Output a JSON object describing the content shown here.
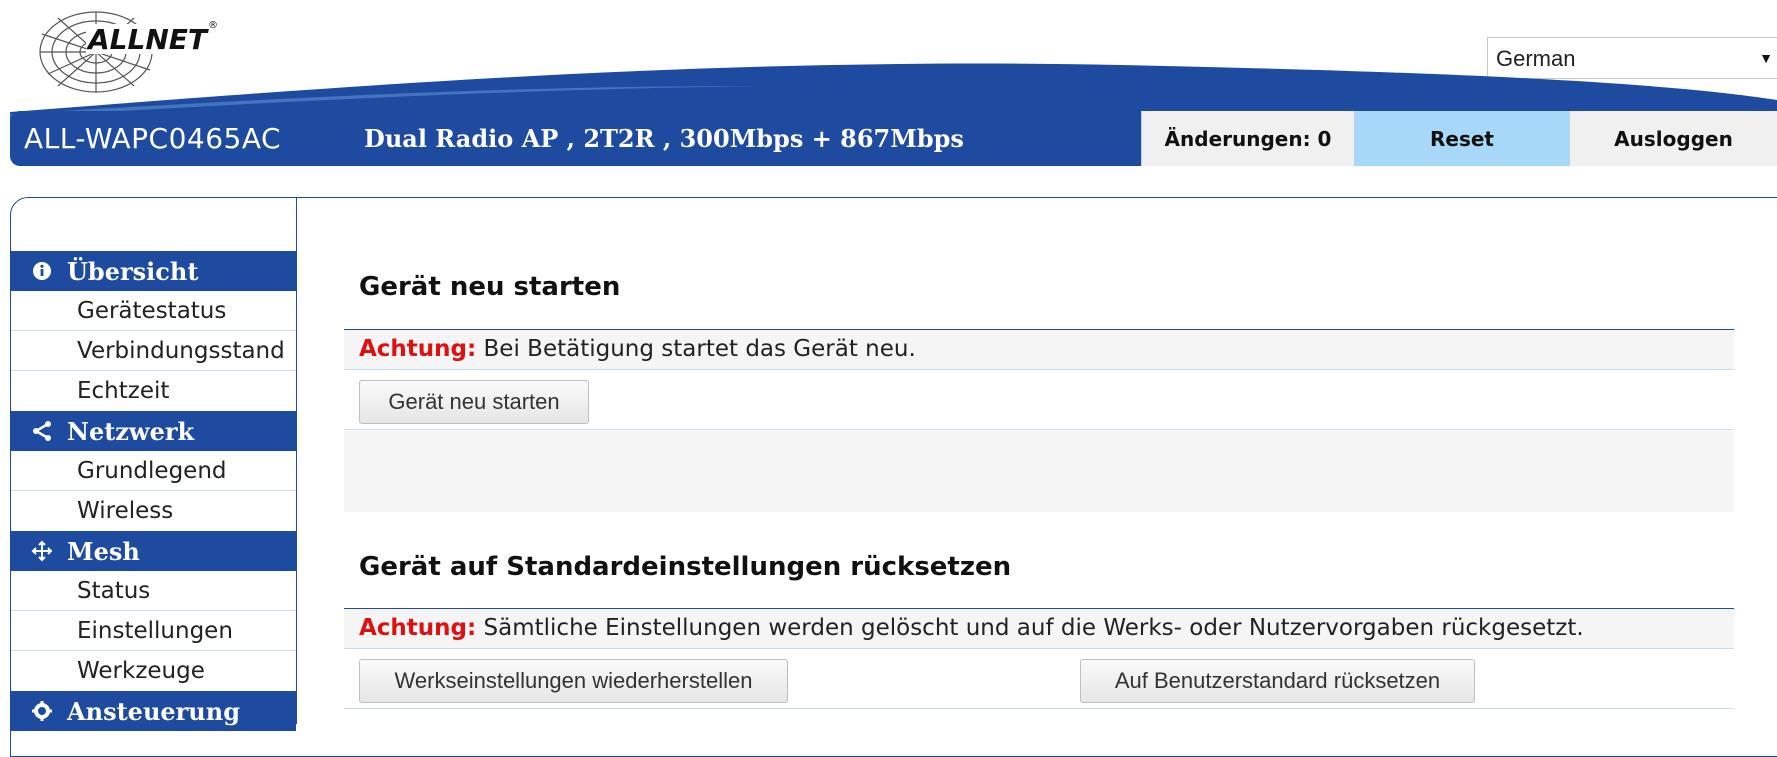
{
  "brand": {
    "logo_text": "ALLNET",
    "registered": "®"
  },
  "language": {
    "selected": "German",
    "arrow_icon": "caret-down-icon"
  },
  "header": {
    "model": "ALL-WAPC0465AC",
    "subtitle": "Dual Radio AP , 2T2R , 300Mbps + 867Mbps",
    "changes_label": "Änderungen: 0",
    "reset_label": "Reset",
    "logout_label": "Ausloggen"
  },
  "sidebar": {
    "sections": [
      {
        "title": "Übersicht",
        "icon": "info-icon",
        "items": [
          "Gerätestatus",
          "Verbindungsstand",
          "Echtzeit"
        ]
      },
      {
        "title": "Netzwerk",
        "icon": "share-icon",
        "items": [
          "Grundlegend",
          "Wireless"
        ]
      },
      {
        "title": "Mesh",
        "icon": "mesh-icon",
        "items": [
          "Status",
          "Einstellungen",
          "Werkzeuge"
        ]
      },
      {
        "title": "Ansteuerung",
        "icon": "gear-icon",
        "items": []
      }
    ]
  },
  "main": {
    "restart": {
      "title": "Gerät neu starten",
      "warn_label": "Achtung:",
      "warn_text": " Bei Betätigung startet das Gerät neu.",
      "button": "Gerät neu starten"
    },
    "factory": {
      "title": "Gerät auf Standardeinstellungen rücksetzen",
      "warn_label": "Achtung:",
      "warn_text": " Sämtliche Einstellungen werden gelöscht und auf die Werks- oder Nutzervorgaben rückgesetzt.",
      "button_factory": "Werkseinstellungen wiederherstellen",
      "button_user": "Auf Benutzerstandard rücksetzen"
    }
  },
  "colors": {
    "brand_blue": "#1e4ba0",
    "warning_red": "#e01010",
    "reset_highlight": "#a8d8f8"
  }
}
